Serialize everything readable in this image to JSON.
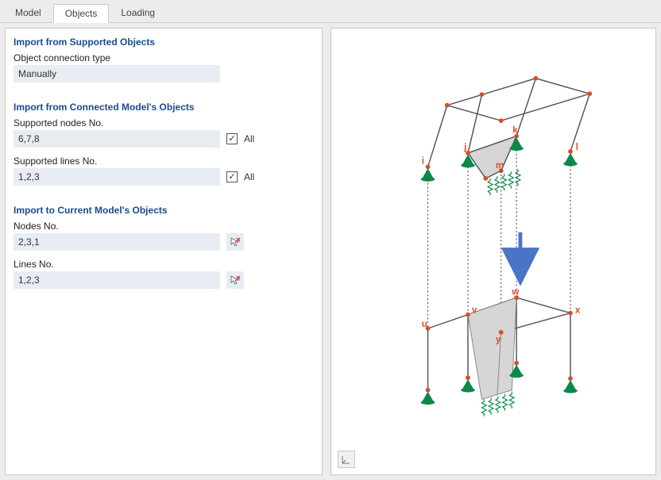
{
  "tabs": {
    "model": "Model",
    "objects": "Objects",
    "loading": "Loading",
    "active": "objects"
  },
  "sections": {
    "supported": {
      "title": "Import from Supported Objects",
      "conn_type_label": "Object connection type",
      "conn_type_value": "Manually"
    },
    "connected": {
      "title": "Import from Connected Model's Objects",
      "nodes_label": "Supported nodes No.",
      "nodes_value": "6,7,8",
      "nodes_all": "All",
      "lines_label": "Supported lines No.",
      "lines_value": "1,2,3",
      "lines_all": "All"
    },
    "current": {
      "title": "Import to Current Model's Objects",
      "nodes_label": "Nodes No.",
      "nodes_value": "2,3,1",
      "lines_label": "Lines No.",
      "lines_value": "1,2,3"
    }
  },
  "diagram": {
    "labels": {
      "i": "i",
      "j": "j",
      "k": "k",
      "l": "l",
      "m": "m",
      "u": "u",
      "v": "v",
      "w": "w",
      "x": "x",
      "y": "y"
    },
    "colors": {
      "frame": "#555",
      "node": "#d94e2a",
      "node_label": "#d94e2a",
      "support": "#0a8a4a",
      "arrow": "#4a74c8",
      "surface_fill": "#d6d6d6",
      "surface_stroke": "#888"
    }
  }
}
